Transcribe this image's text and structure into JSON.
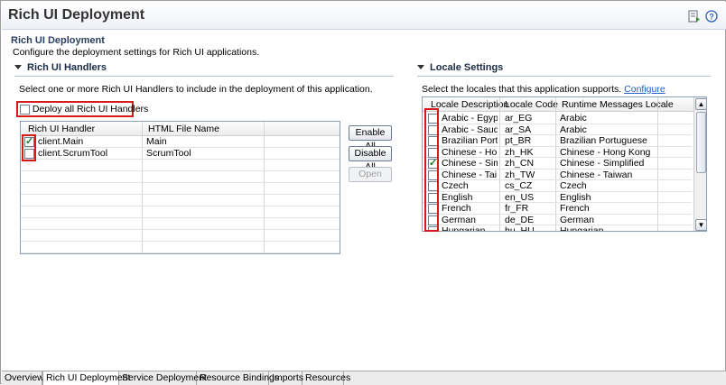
{
  "page": {
    "title": "Rich UI Deployment"
  },
  "section": {
    "title": "Rich UI Deployment",
    "description": "Configure the deployment settings for Rich UI applications."
  },
  "handlers": {
    "title": "Rich UI Handlers",
    "instructions": "Select one or more Rich UI Handlers to include in the deployment of this application.",
    "deploy_all_label": "Deploy all Rich UI Handlers",
    "deploy_all_checked": false,
    "columns": [
      "Rich UI Handler",
      "HTML File Name"
    ],
    "rows": [
      {
        "handler": "client.Main",
        "html": "Main",
        "checked": true
      },
      {
        "handler": "client.ScrumTool",
        "html": "ScrumTool",
        "checked": false
      }
    ],
    "buttons": {
      "enable_all": "Enable All",
      "disable_all": "Disable All",
      "open": "Open"
    }
  },
  "locales": {
    "title": "Locale Settings",
    "instructions": "Select the locales that this application supports.",
    "configure_link": "Configure",
    "columns": [
      "Locale Description",
      "Locale Code",
      "Runtime Messages Locale"
    ],
    "rows": [
      {
        "desc": "Arabic - Egypt",
        "code": "ar_EG",
        "runtime": "Arabic",
        "checked": false
      },
      {
        "desc": "Arabic - Saud...",
        "code": "ar_SA",
        "runtime": "Arabic",
        "checked": false
      },
      {
        "desc": "Brazilian Port...",
        "code": "pt_BR",
        "runtime": "Brazilian Portuguese",
        "checked": false
      },
      {
        "desc": "Chinese - Ho...",
        "code": "zh_HK",
        "runtime": "Chinese - Hong Kong",
        "checked": false
      },
      {
        "desc": "Chinese - Sim...",
        "code": "zh_CN",
        "runtime": "Chinese - Simplified",
        "checked": true
      },
      {
        "desc": "Chinese - Tai...",
        "code": "zh_TW",
        "runtime": "Chinese - Taiwan",
        "checked": false
      },
      {
        "desc": "Czech",
        "code": "cs_CZ",
        "runtime": "Czech",
        "checked": false
      },
      {
        "desc": "English",
        "code": "en_US",
        "runtime": "English",
        "checked": false
      },
      {
        "desc": "French",
        "code": "fr_FR",
        "runtime": "French",
        "checked": false
      },
      {
        "desc": "German",
        "code": "de_DE",
        "runtime": "German",
        "checked": false
      },
      {
        "desc": "Hungarian",
        "code": "hu_HU",
        "runtime": "Hungarian",
        "checked": false
      }
    ]
  },
  "tabs": [
    "Overview",
    "Rich UI Deployment",
    "Service Deployment",
    "Resource Bindings",
    "Imports",
    "Resources"
  ],
  "active_tab": "Rich UI Deployment",
  "icons": {
    "header_left": "deploy-icon",
    "header_right": "help-icon"
  },
  "colors": {
    "highlight": "#d41a1a",
    "link": "#1f5fc6",
    "title": "#333333"
  }
}
